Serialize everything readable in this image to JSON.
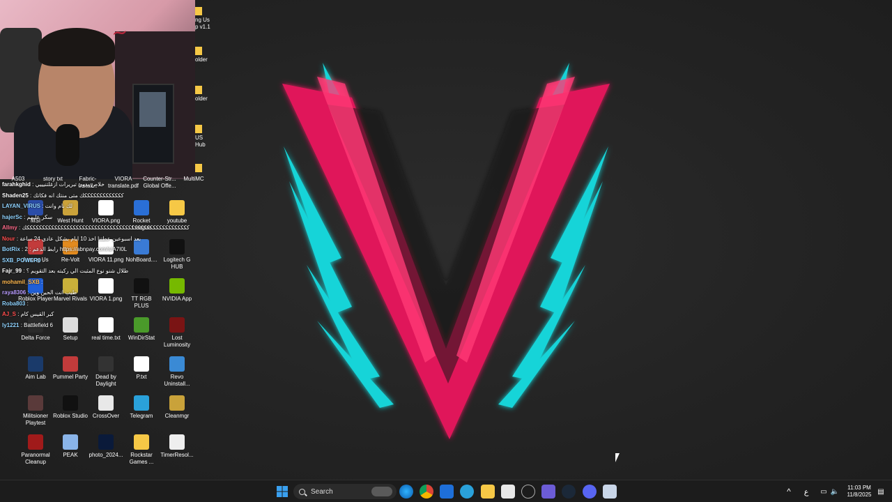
{
  "strip_labels": [
    "ng Us",
    "p v1.1",
    "older",
    "older",
    "US",
    "Hub"
  ],
  "top_labels": [
    "A503",
    "story txt",
    "Fabric-Install...",
    "VIORA translate.pdf",
    "Counter-Str... Global Offe...",
    "MultiMC"
  ],
  "icons": [
    {
      "label": "MSI",
      "color": "#2b4da8"
    },
    {
      "label": "West Hunt",
      "color": "#caa23a"
    },
    {
      "label": "VIORA.png",
      "color": "#ffffff"
    },
    {
      "label": "Rocket League",
      "color": "#2a6fd6"
    },
    {
      "label": "youtube",
      "color": "#f6c846"
    },
    {
      "label": "Among Us",
      "color": "#c23b3b"
    },
    {
      "label": "Re-Volt",
      "color": "#e38b1f"
    },
    {
      "label": "VIORA 11.png",
      "color": "#ffffff"
    },
    {
      "label": "NohBoard....",
      "color": "#3a7bd5"
    },
    {
      "label": "Logitech G HUB",
      "color": "#111111"
    },
    {
      "label": "Roblox Player",
      "color": "#1f5fd8"
    },
    {
      "label": "Marvel Rivals",
      "color": "#c9b03a"
    },
    {
      "label": "VIORA 1.png",
      "color": "#ffffff"
    },
    {
      "label": "TT RGB PLUS",
      "color": "#111111"
    },
    {
      "label": "NVIDIA App",
      "color": "#76b900"
    },
    {
      "label": "Delta Force",
      "color": "#2b2b2b"
    },
    {
      "label": "Setup",
      "color": "#dddddd"
    },
    {
      "label": "real time.txt",
      "color": "#ffffff"
    },
    {
      "label": "WinDirStat",
      "color": "#4a9a2a"
    },
    {
      "label": "Lost Luminosity",
      "color": "#7a1414"
    },
    {
      "label": "Aim Lab",
      "color": "#1a3a6a"
    },
    {
      "label": "Pummel Party",
      "color": "#c23b3b"
    },
    {
      "label": "Dead by Daylight",
      "color": "#333333"
    },
    {
      "label": "P.txt",
      "color": "#ffffff"
    },
    {
      "label": "Revo Uninstall...",
      "color": "#3a8ad5"
    },
    {
      "label": "Militsioner Playtest",
      "color": "#5a3a3a"
    },
    {
      "label": "Roblox Studio",
      "color": "#111111"
    },
    {
      "label": "CrossOver",
      "color": "#e8e8e8"
    },
    {
      "label": "Telegram",
      "color": "#2aa1da"
    },
    {
      "label": "Cleanmgr",
      "color": "#c9a23a"
    },
    {
      "label": "Paranormal Cleanup",
      "color": "#a01a1a"
    },
    {
      "label": "PEAK",
      "color": "#8ab4e8"
    },
    {
      "label": "photo_2024...",
      "color": "#0a1a3a"
    },
    {
      "label": "Rockstar Games ...",
      "color": "#f6c846"
    },
    {
      "label": "TimerResol...",
      "color": "#eeeeee"
    }
  ],
  "chat": [
    {
      "user": "farahkghid",
      "msg": ": خلاص بدون تبريرات ازغلتنيييي",
      "color": "#ffffff"
    },
    {
      "user": "Shaden25",
      "msg": ": كككككككككككككك متى منتك انه فكاتك",
      "color": "#ffffff"
    },
    {
      "user": "LAYAN_VIRUS",
      "msg": ": لك نام وانت",
      "color": "#8fd3ff"
    },
    {
      "user": "hajerSc",
      "msg": ": سكر عليهم",
      "color": "#8fd3ff"
    },
    {
      "user": "Allmy",
      "msg": ": كككككككككككككككككككككككككككككككككككككككككككككككككككككك",
      "color": "#ff6b8a"
    },
    {
      "user": "Nour",
      "msg": ": بعد اسبوعين عطتنا اخذ 10 ايام بشكل عادي 24 ساعة",
      "color": "#ff4d4d"
    },
    {
      "user": "BotRix",
      "msg": ": 2 : رابط الدعم https://abnpay.com/s/A7I0L",
      "color": "#8fd3ff"
    },
    {
      "user": "SXB_POWER0",
      "msg": ":",
      "color": "#8fd3ff"
    },
    {
      "user": "Fajr_99",
      "msg": ": طلال شنو نوع المثبت الي ركبته بعد التقويم ؟",
      "color": "#ffffff"
    },
    {
      "user": "mohamil_SXB",
      "msg": ":",
      "color": "#ffb84d"
    },
    {
      "user": "raya8306",
      "msg": ": طيب انت الحين وين",
      "color": "#b99cff"
    },
    {
      "user": "Roba803",
      "msg": ":",
      "color": "#8fd3ff"
    },
    {
      "user": "AJ_S",
      "msg": ": كبر القيس كام",
      "color": "#ff4d4d"
    },
    {
      "user": "ly1221",
      "msg": ": Battlefield 6",
      "color": "#8fd3ff"
    }
  ],
  "taskbar": {
    "search_placeholder": "Search",
    "apps": [
      "windows",
      "search",
      "widget",
      "edge",
      "chrome",
      "app1",
      "telegram",
      "explorer",
      "store",
      "app2",
      "app3",
      "steam",
      "discord",
      "app4"
    ],
    "clock_time": "11:03 PM",
    "clock_date": "11/8/2025",
    "lang": "ع"
  },
  "colors": {
    "cyan": "#19d4d8",
    "pink": "#e0185a",
    "dark": "#1a1a1a"
  }
}
